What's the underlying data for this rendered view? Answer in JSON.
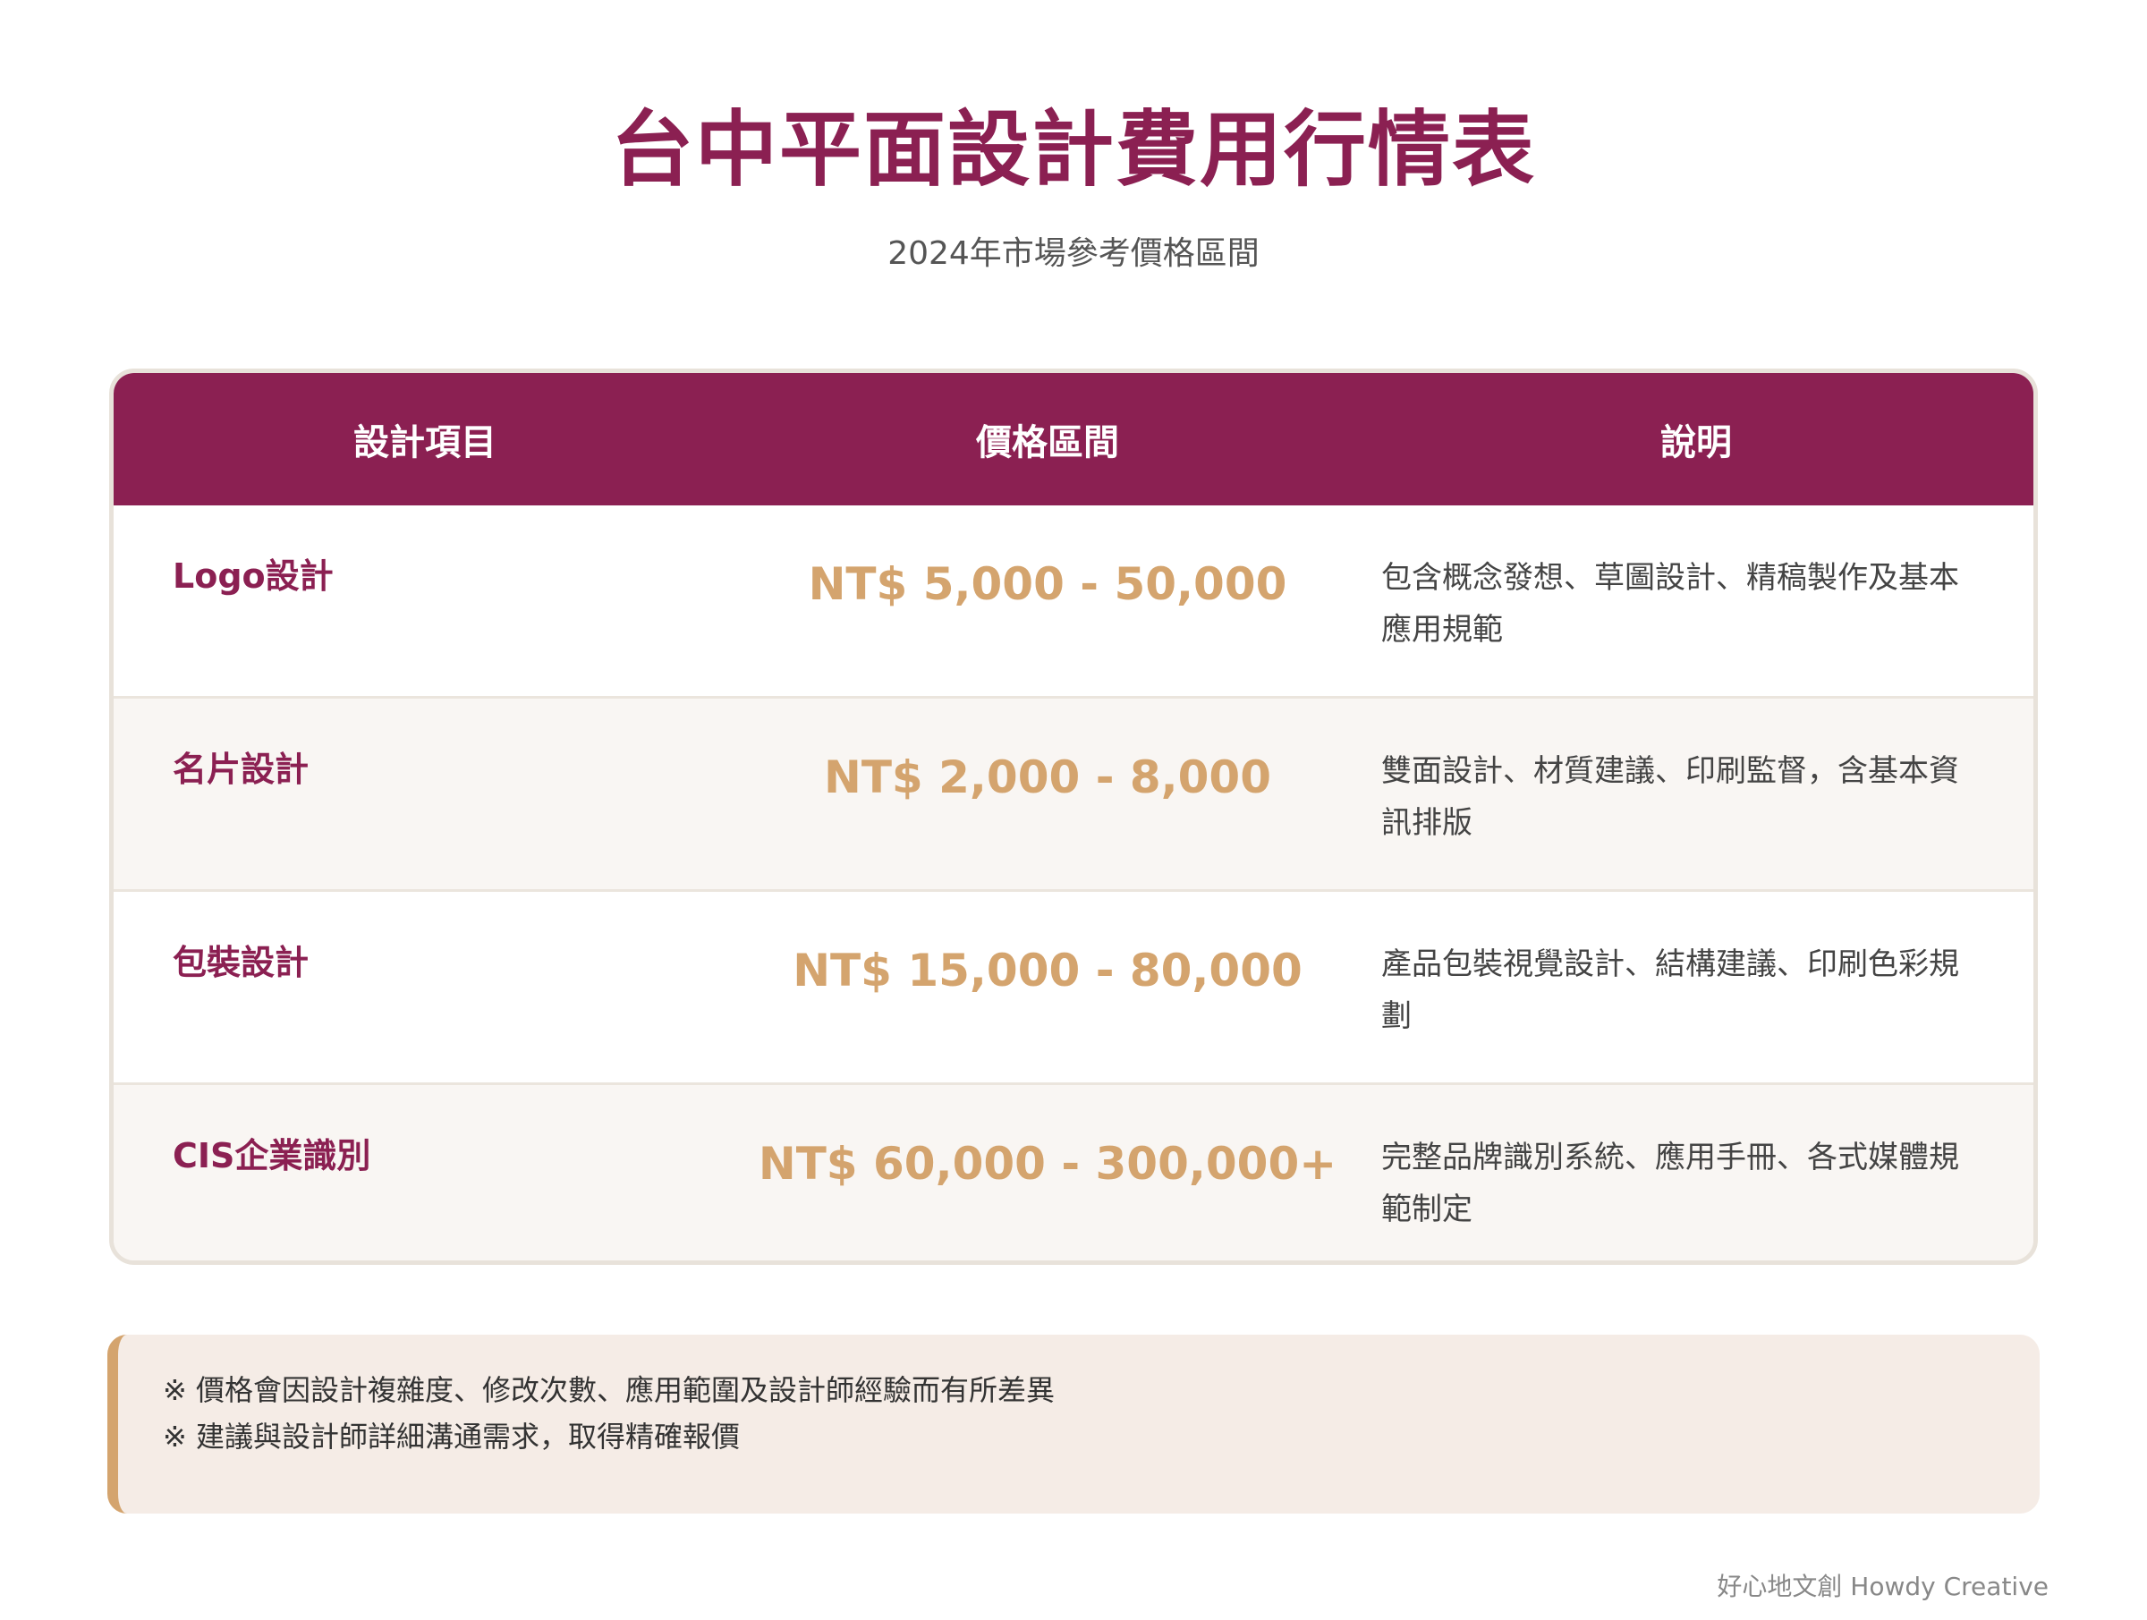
{
  "title": "台中平面設計費用行情表",
  "subtitle": "2024年市場參考價格區間",
  "table": {
    "headers": [
      "設計項目",
      "價格區間",
      "說明"
    ],
    "rows": [
      {
        "item": "Logo設計",
        "price": "NT$ 5,000 - 50,000",
        "desc": "包含概念發想、草圖設計、精稿製作及基本應用規範"
      },
      {
        "item": "名片設計",
        "price": "NT$ 2,000 - 8,000",
        "desc": "雙面設計、材質建議、印刷監督，含基本資訊排版"
      },
      {
        "item": "包裝設計",
        "price": "NT$ 15,000 - 80,000",
        "desc": "產品包裝視覺設計、結構建議、印刷色彩規劃"
      },
      {
        "item": "CIS企業識別",
        "price": "NT$ 60,000 - 300,000+",
        "desc": "完整品牌識別系統、應用手冊、各式媒體規範制定"
      }
    ]
  },
  "notes": [
    "※ 價格會因設計複雜度、修改次數、應用範圍及設計師經驗而有所差異",
    "※ 建議與設計師詳細溝通需求，取得精確報價"
  ],
  "footer": "好心地文創 Howdy Creative",
  "colors": {
    "primary": "#8b2052",
    "price": "#d4a46e",
    "note_bg": "#f5ece6",
    "row_alt": "#f9f6f3"
  }
}
